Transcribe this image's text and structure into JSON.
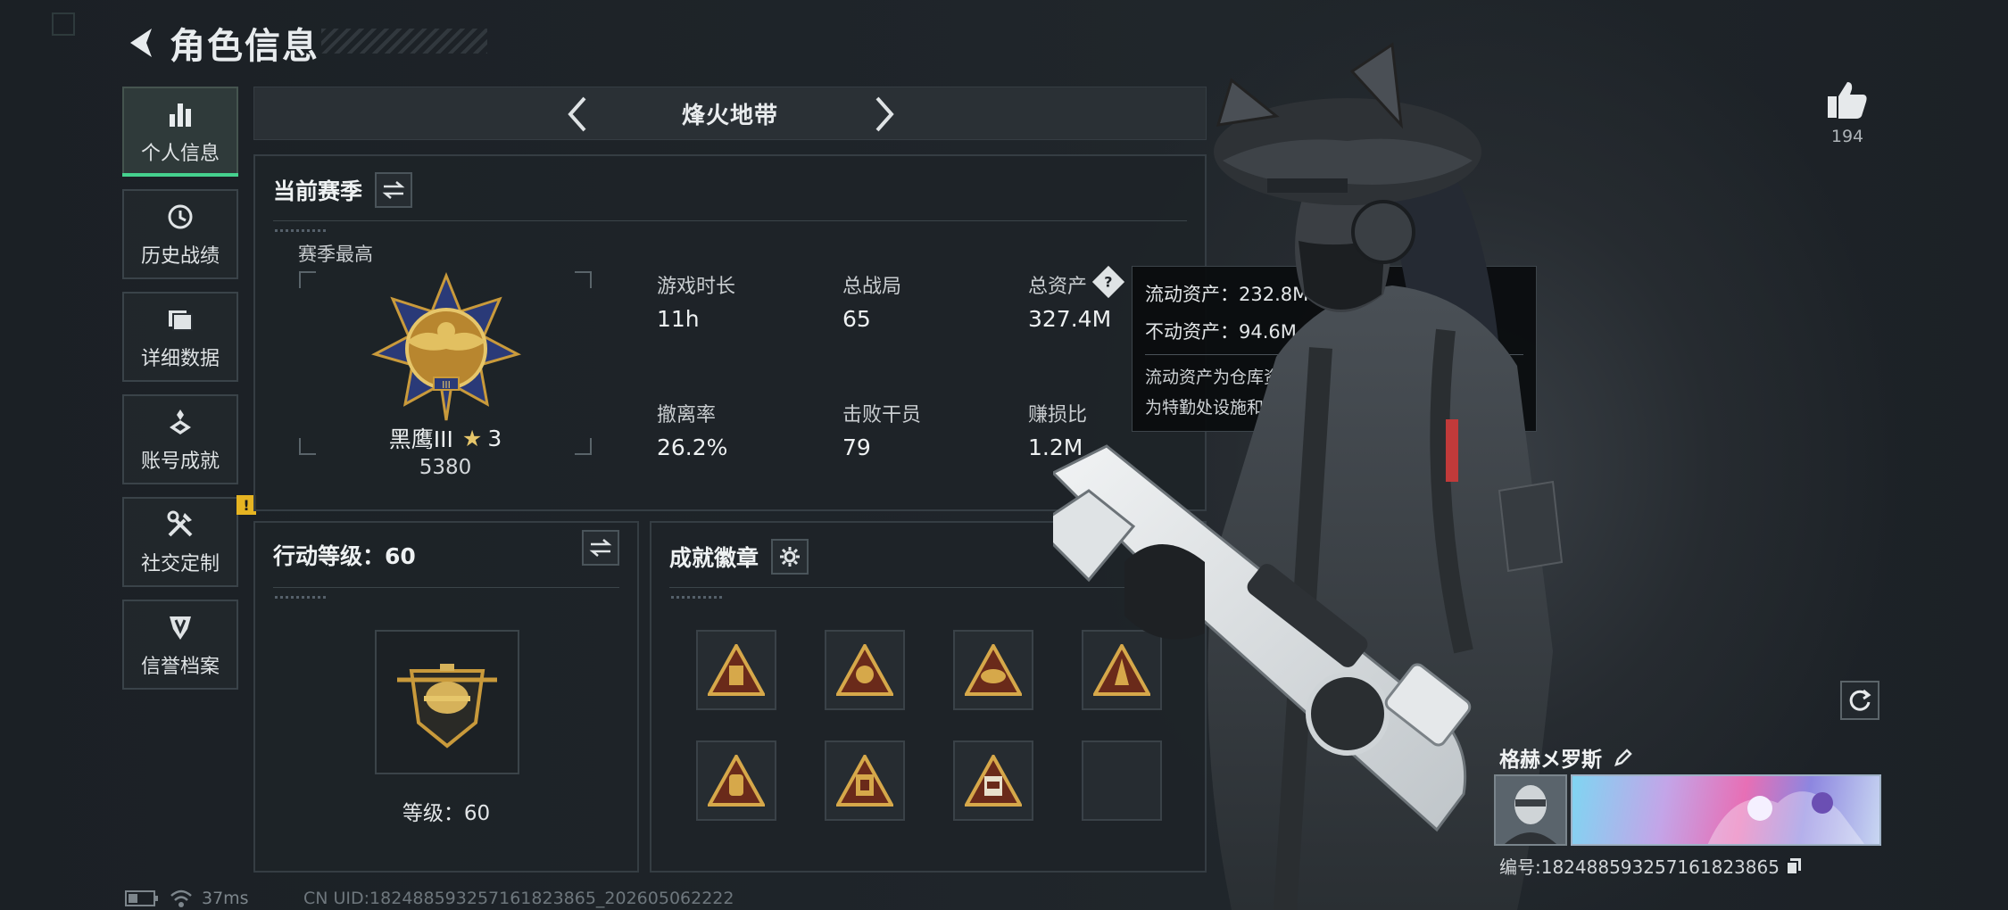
{
  "header": {
    "title": "角色信息"
  },
  "sidebar": {
    "items": [
      {
        "label": "个人信息",
        "icon": "bar-chart-icon",
        "active": true
      },
      {
        "label": "历史战绩",
        "icon": "history-icon"
      },
      {
        "label": "详细数据",
        "icon": "folder-icon"
      },
      {
        "label": "账号成就",
        "icon": "achievement-icon"
      },
      {
        "label": "社交定制",
        "icon": "tools-icon",
        "badge": "!"
      },
      {
        "label": "信誉档案",
        "icon": "shield-icon"
      }
    ]
  },
  "mode": {
    "title": "烽火地带"
  },
  "season": {
    "title": "当前赛季",
    "best_label": "赛季最高",
    "rank_name": "黑鹰III",
    "rank_stars": "3",
    "rank_score": "5380",
    "stats": [
      {
        "label": "游戏时长",
        "value": "11h"
      },
      {
        "label": "总战局",
        "value": "65"
      },
      {
        "label": "总资产",
        "value": "327.4M"
      },
      {
        "label": "撤离率",
        "value": "26.2%"
      },
      {
        "label": "击败干员",
        "value": "79"
      },
      {
        "label": "赚损比",
        "value": "1.2M"
      }
    ]
  },
  "tooltip": {
    "liquid": "流动资产：232.8M",
    "fixed": "不动资产：94.6M",
    "desc_line1": "流动资产为仓库资产和哈夫币，不动资产",
    "desc_line2": "为特勤处设施和收藏室设施"
  },
  "action_level": {
    "title": "行动等级：60",
    "level_text": "等级：60"
  },
  "badges": {
    "title": "成就徽章",
    "items": [
      "badge-1",
      "badge-2",
      "badge-3",
      "badge-4",
      "badge-5",
      "badge-6",
      "badge-7",
      "empty"
    ]
  },
  "like": {
    "count": "194"
  },
  "player": {
    "name": "格赫メ罗斯",
    "id_text": "编号:1824885932571618238​65"
  },
  "status": {
    "ping": "37ms",
    "uid": "CN UID:1824885932571618238​65_202605062222"
  },
  "colors": {
    "accent": "#45d18e",
    "warning": "#e6b422",
    "gold": "#c99a3b"
  }
}
